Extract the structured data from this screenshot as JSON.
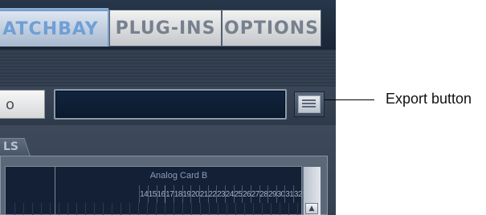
{
  "tabs": [
    {
      "label": "ATCHBAY",
      "active": true
    },
    {
      "label": "PLUG-INS",
      "active": false
    },
    {
      "label": "OPTIONS",
      "active": false
    }
  ],
  "name_field": {
    "value": "o"
  },
  "display_field": {
    "value": ""
  },
  "export_button": {
    "icon": "document-lines-icon"
  },
  "panel_tab": {
    "label": "LS"
  },
  "grid": {
    "group_header": "Analog Card B",
    "channels_left": [
      "14",
      "15",
      "16"
    ],
    "channels_right": [
      "17",
      "18",
      "19",
      "20",
      "21",
      "22",
      "23",
      "24",
      "25",
      "26",
      "27",
      "28",
      "29",
      "30",
      "31",
      "32"
    ],
    "scroll_icon": "up-arrow-icon"
  },
  "callout": {
    "label": "Export button"
  },
  "colors": {
    "accent": "#6f9fd6",
    "display_bg": "#0b1a2e",
    "panel_bg": "#3d4a5a"
  }
}
